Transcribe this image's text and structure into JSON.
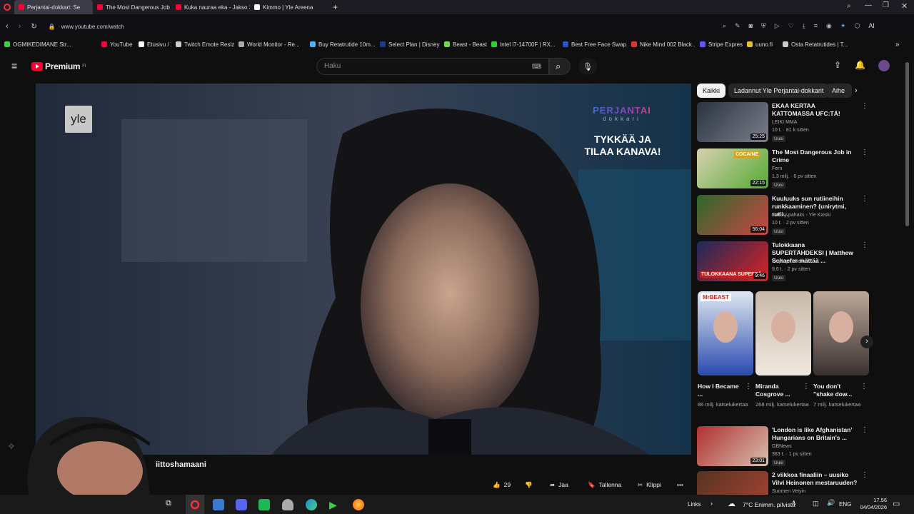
{
  "browser": {
    "tabs": [
      {
        "label": "Perjantai-dokkari: Se",
        "active": true,
        "color": "#ff0033"
      },
      {
        "label": "The Most Dangerous Job",
        "active": false,
        "color": "#ff0033"
      },
      {
        "label": "Kuka nauraa eka - Jakso 2",
        "active": false,
        "color": "#ff0033"
      },
      {
        "label": "Kimmo | Yle Areena",
        "active": false,
        "color": "#ffffff"
      }
    ],
    "url": "www.youtube.com/watch",
    "ai_label": "AI",
    "bookmarks": [
      {
        "label": "OGMIKEDIMANE Str...",
        "color": "#3ecf4a"
      },
      {
        "label": "YouTube",
        "color": "#ff0033"
      },
      {
        "label": "Etusivu / X",
        "color": "#ffffff"
      },
      {
        "label": "Twitch Emote Resizer",
        "color": "#cccccc"
      },
      {
        "label": "World Monitor - Re...",
        "color": "#aaaaaa"
      },
      {
        "label": "Buy Retatrutide 10m...",
        "color": "#4ab0ff"
      },
      {
        "label": "Select Plan | Disney+",
        "color": "#1c3b8a"
      },
      {
        "label": "Beast - Beast",
        "color": "#66dd44"
      },
      {
        "label": "Intel i7-14700F | RX...",
        "color": "#33cc33"
      },
      {
        "label": "Best Free Face Swap...",
        "color": "#2255cc"
      },
      {
        "label": "Nike Mind 002 Black...",
        "color": "#dd3333"
      },
      {
        "label": "Stripe Express",
        "color": "#6355ff"
      },
      {
        "label": "uuno.fi",
        "color": "#e8c020"
      },
      {
        "label": "Osta Retatrutides | T...",
        "color": "#cccccc"
      }
    ]
  },
  "youtube": {
    "brand": "Premium",
    "brand_sup": "FI",
    "search_placeholder": "Haku",
    "video": {
      "corner_logo": "yle",
      "channel_logo": "PERJANTAI",
      "channel_logo_sub": "dokkari",
      "cta_line1": "TYKKÄÄ JA",
      "cta_line2": "TILAA KANAVA!"
    },
    "video_title_partial": "iittoshamaani",
    "actions": {
      "likes": "29",
      "share": "Jaa",
      "save": "Tallenna",
      "clip": "Klippi"
    },
    "chips": [
      "Kaikki",
      "Ladannut Yle Perjantai-dokkarit",
      "Aihe"
    ],
    "recommendations": [
      {
        "title": "EKAA KERTAA KATTOMASSA UFC:TÄ!",
        "channel": "LEIKI MMA",
        "meta": "10 t. · 81 k sitten",
        "badge": "Uusi",
        "duration": "25:25",
        "color1": "#2b3340",
        "color2": "#7a7f8a"
      },
      {
        "title": "The Most Dangerous Job in Crime",
        "channel": "Fern",
        "meta": "1,3 milj. · 6 pv sitten",
        "badge": "Uusi",
        "duration": "22:15",
        "thumb_text": "COCAINE",
        "color1": "#d8d0b0",
        "color2": "#55aa33"
      },
      {
        "title": "Kuuluuks sun rutiineihin runkkaaminen? (unirytmi, rutii...",
        "channel": "Menny pahaks - Yle Kioski",
        "meta": "10 t. · 2 pv sitten",
        "badge": "Uusi",
        "duration": "56:04",
        "color1": "#2a6a2a",
        "color2": "#cc4444"
      },
      {
        "title": "Tulokkaana SUPERTÄHDEKSI | Matthew Schaefer mättää ...",
        "channel": "Viaplay Urheilu",
        "meta": "9,6 t. · 2 pv sitten",
        "badge": "Uusi",
        "duration": "9:46",
        "thumb_text": "TULOKKAANA SUPERTÄ",
        "color1": "#1a2a5a",
        "color2": "#dd2222"
      },
      {
        "title": "'London is like Afghanistan' Hungarians on Britain's ...",
        "channel": "GBNews",
        "meta": "383 t. · 1 pv sitten",
        "badge": "Uusi",
        "duration": "23:01",
        "color1": "#b03030",
        "color2": "#d8c0b0"
      },
      {
        "title": "2 viikkoa finaaliin – uusiko Vilvi Heinonen mestaruuden?",
        "channel": "Suomen Vetyin",
        "meta": "",
        "badge": "",
        "duration": "",
        "color1": "#553322",
        "color2": "#aa4433"
      }
    ],
    "shorts": [
      {
        "title": "How I Became ...",
        "views": "86 milj. katselukertaa",
        "thumb_text": "MrBEAST",
        "color1": "#e0e8f0",
        "color2": "#2a4ab0"
      },
      {
        "title": "Miranda Cosgrove ...",
        "views": "268 milj. katselukertaa",
        "color1": "#c8b8a8",
        "color2": "#f0e8e0"
      },
      {
        "title": "You don't \"shake dow...",
        "views": "7 milj. katselukertaa",
        "color1": "#bba898",
        "color2": "#3a3030"
      }
    ]
  },
  "taskbar": {
    "links": "Links",
    "weather": "7°C  Enimm. pilvistä",
    "lang": "ENG",
    "time": "17.56",
    "date": "04/04/2026"
  }
}
